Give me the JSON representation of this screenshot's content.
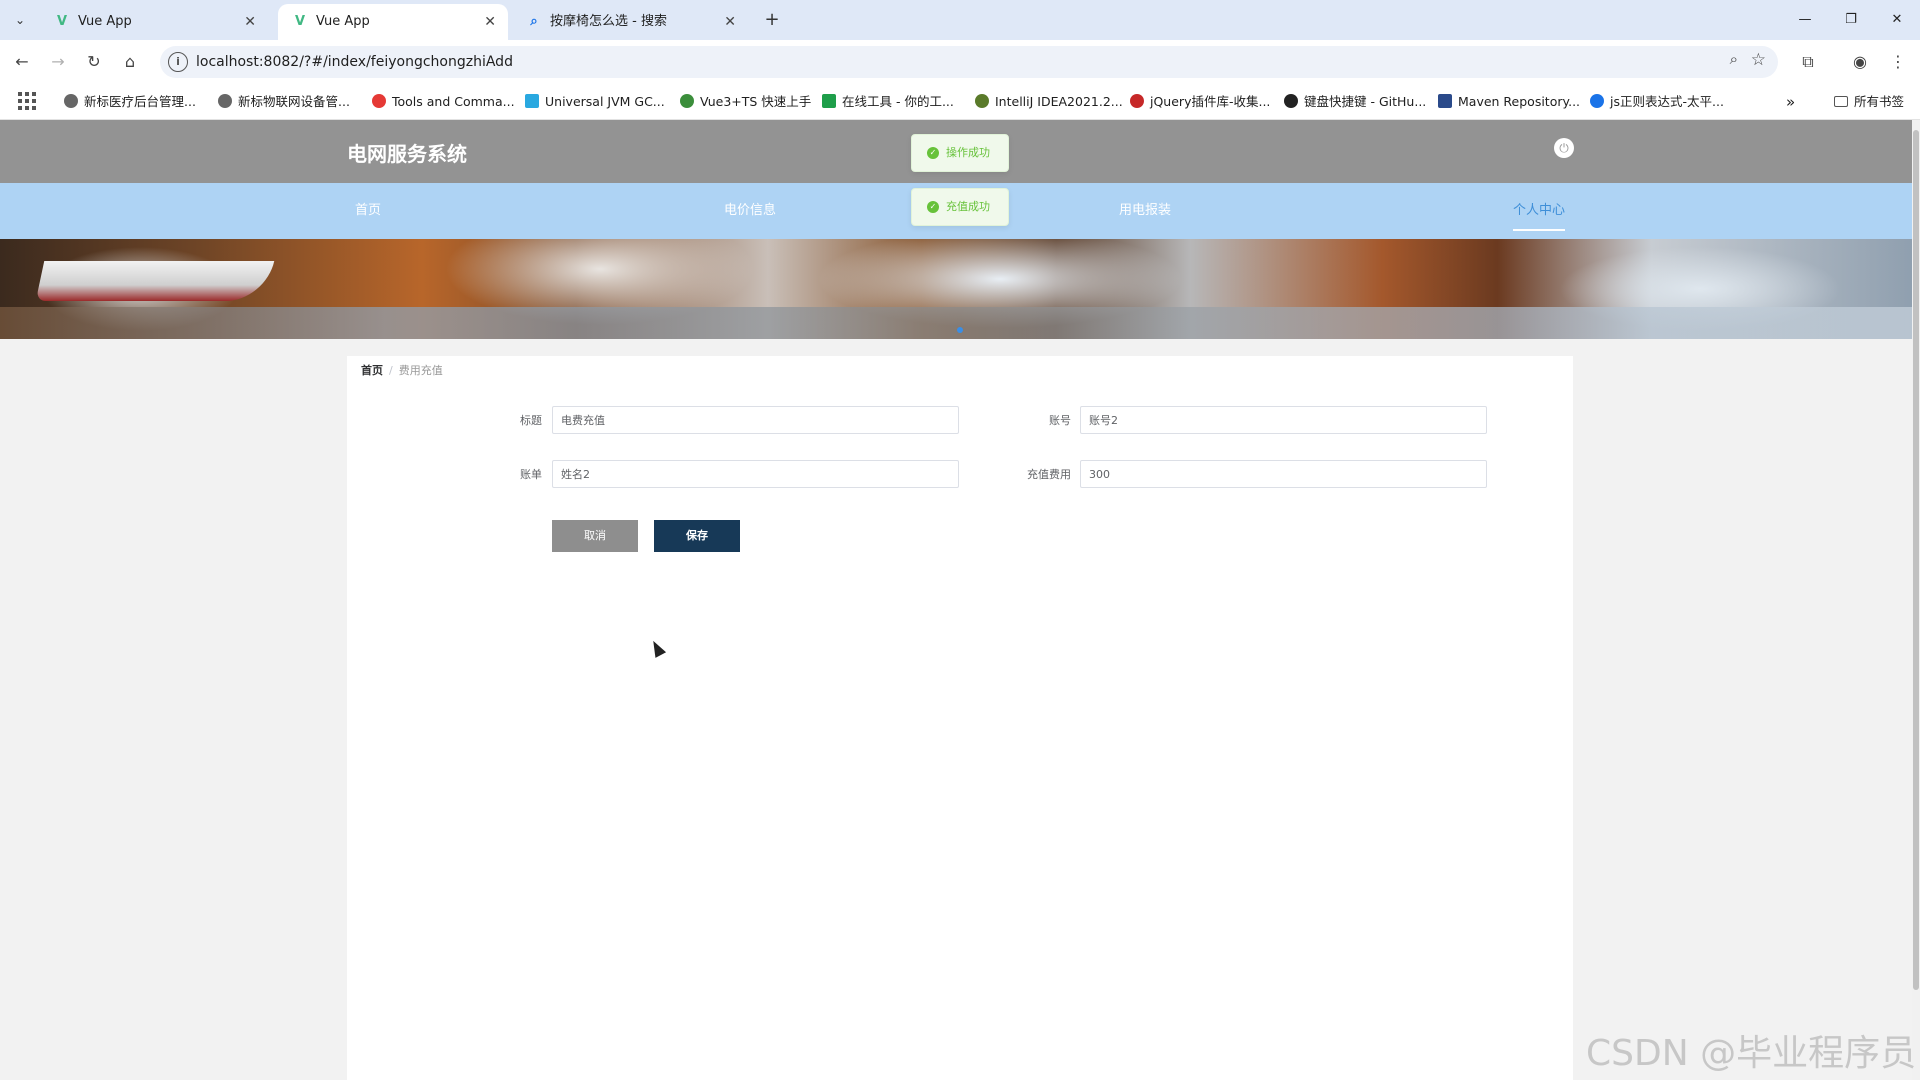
{
  "browser": {
    "tabs": [
      {
        "title": "Vue App",
        "icon": "vue-icon",
        "active": false
      },
      {
        "title": "Vue App",
        "icon": "vue-icon",
        "active": true
      },
      {
        "title": "按摩椅怎么选 - 搜索",
        "icon": "search-icon",
        "active": false
      }
    ],
    "new_tab_glyph": "+",
    "url": "localhost:8082/?#/index/feiyongchongzhiAdd",
    "bookmarks": [
      "新标医疗后台管理...",
      "新标物联网设备管...",
      "Tools and Comma...",
      "Universal JVM GC...",
      "Vue3+TS 快速上手",
      "在线工具 - 你的工...",
      "IntelliJ IDEA2021.2...",
      "jQuery插件库-收集...",
      "键盘快捷键 - GitHu...",
      "Maven Repository...",
      "js正则表达式-太平..."
    ],
    "bookmarks_overflow": "»",
    "all_bookmarks": "所有书签"
  },
  "site": {
    "title": "电网服务系统",
    "nav": [
      {
        "label": "首页",
        "active": false
      },
      {
        "label": "电价信息",
        "active": false
      },
      {
        "label": "用电报装",
        "active": false
      },
      {
        "label": "个人中心",
        "active": true
      }
    ]
  },
  "toasts": [
    "操作成功",
    "充值成功"
  ],
  "breadcrumb": {
    "home": "首页",
    "separator": "/",
    "current": "费用充值"
  },
  "form": {
    "fields": [
      {
        "label": "标题",
        "value": "电费充值"
      },
      {
        "label": "账号",
        "value": "账号2"
      },
      {
        "label": "账单",
        "value": "姓名2"
      },
      {
        "label": "充值费用",
        "value": "300"
      }
    ],
    "cancel_label": "取消",
    "save_label": "保存"
  },
  "watermark": "CSDN @毕业程序员",
  "colors": {
    "header": "#939393",
    "nav": "#aed3f4",
    "nav_active": "#3f8fd8",
    "save_button": "#173957",
    "cancel_button": "#8e8e8e",
    "toast_success": "#67c23a"
  }
}
